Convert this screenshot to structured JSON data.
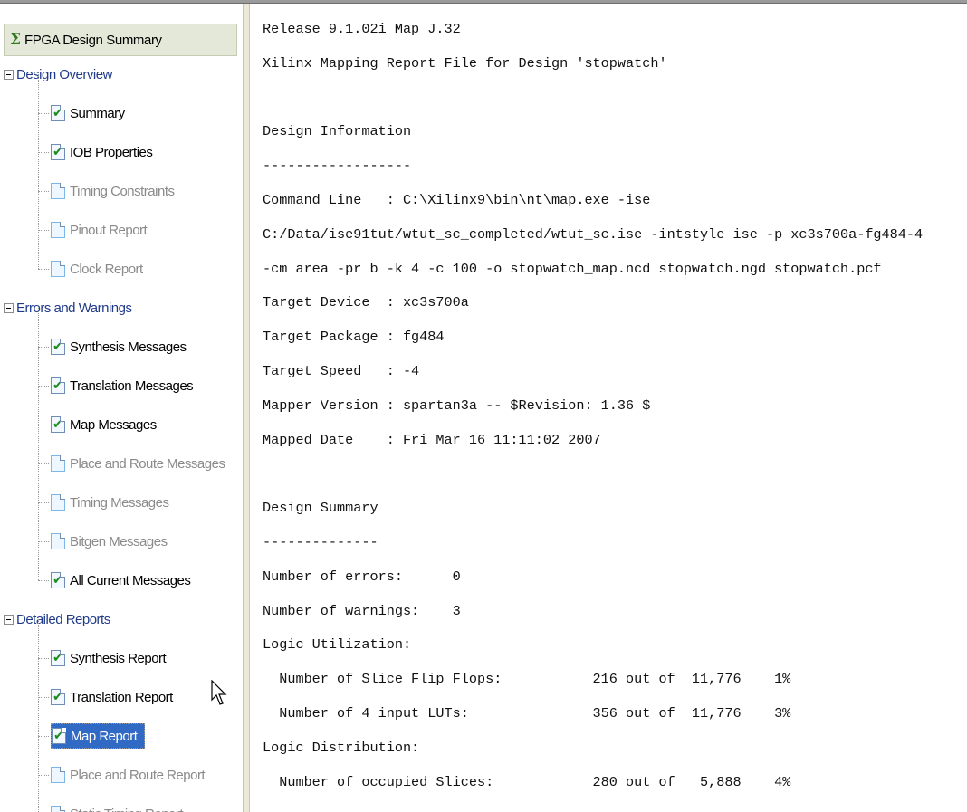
{
  "sidebar": {
    "root": {
      "label": "FPGA Design Summary",
      "icon": "sigma-icon"
    },
    "groups": [
      {
        "label": "Design Overview",
        "items": [
          {
            "label": "Summary",
            "status": "done"
          },
          {
            "label": "IOB Properties",
            "status": "done"
          },
          {
            "label": "Timing Constraints",
            "status": "pending"
          },
          {
            "label": "Pinout Report",
            "status": "pending"
          },
          {
            "label": "Clock Report",
            "status": "pending"
          }
        ]
      },
      {
        "label": "Errors and Warnings",
        "items": [
          {
            "label": "Synthesis Messages",
            "status": "done"
          },
          {
            "label": "Translation Messages",
            "status": "done"
          },
          {
            "label": "Map Messages",
            "status": "done"
          },
          {
            "label": "Place and Route Messages",
            "status": "pending"
          },
          {
            "label": "Timing Messages",
            "status": "pending"
          },
          {
            "label": "Bitgen Messages",
            "status": "pending"
          },
          {
            "label": "All Current Messages",
            "status": "done"
          }
        ]
      },
      {
        "label": "Detailed Reports",
        "items": [
          {
            "label": "Synthesis Report",
            "status": "done"
          },
          {
            "label": "Translation Report",
            "status": "done"
          },
          {
            "label": "Map Report",
            "status": "done",
            "selected": true
          },
          {
            "label": "Place and Route Report",
            "status": "pending"
          },
          {
            "label": "Static Timing Report",
            "status": "pending"
          }
        ]
      }
    ]
  },
  "report": {
    "lines": [
      "Release 9.1.02i Map J.32",
      "Xilinx Mapping Report File for Design 'stopwatch'",
      "",
      "Design Information",
      "------------------",
      "Command Line   : C:\\Xilinx9\\bin\\nt\\map.exe -ise",
      "C:/Data/ise91tut/wtut_sc_completed/wtut_sc.ise -intstyle ise -p xc3s700a-fg484-4",
      "-cm area -pr b -k 4 -c 100 -o stopwatch_map.ncd stopwatch.ngd stopwatch.pcf",
      "Target Device  : xc3s700a",
      "Target Package : fg484",
      "Target Speed   : -4",
      "Mapper Version : spartan3a -- $Revision: 1.36 $",
      "Mapped Date    : Fri Mar 16 11:11:02 2007",
      "",
      "Design Summary",
      "--------------",
      "Number of errors:      0",
      "Number of warnings:    3",
      "Logic Utilization:",
      "  Number of Slice Flip Flops:           216 out of  11,776    1%",
      "  Number of 4 input LUTs:               356 out of  11,776    3%",
      "Logic Distribution:",
      "  Number of occupied Slices:            280 out of   5,888    4%"
    ]
  },
  "colors": {
    "selection": "#316ac5",
    "group_label": "#1f3a8a",
    "inactive_label": "#8a8a8a",
    "check": "#1d8b1d"
  }
}
